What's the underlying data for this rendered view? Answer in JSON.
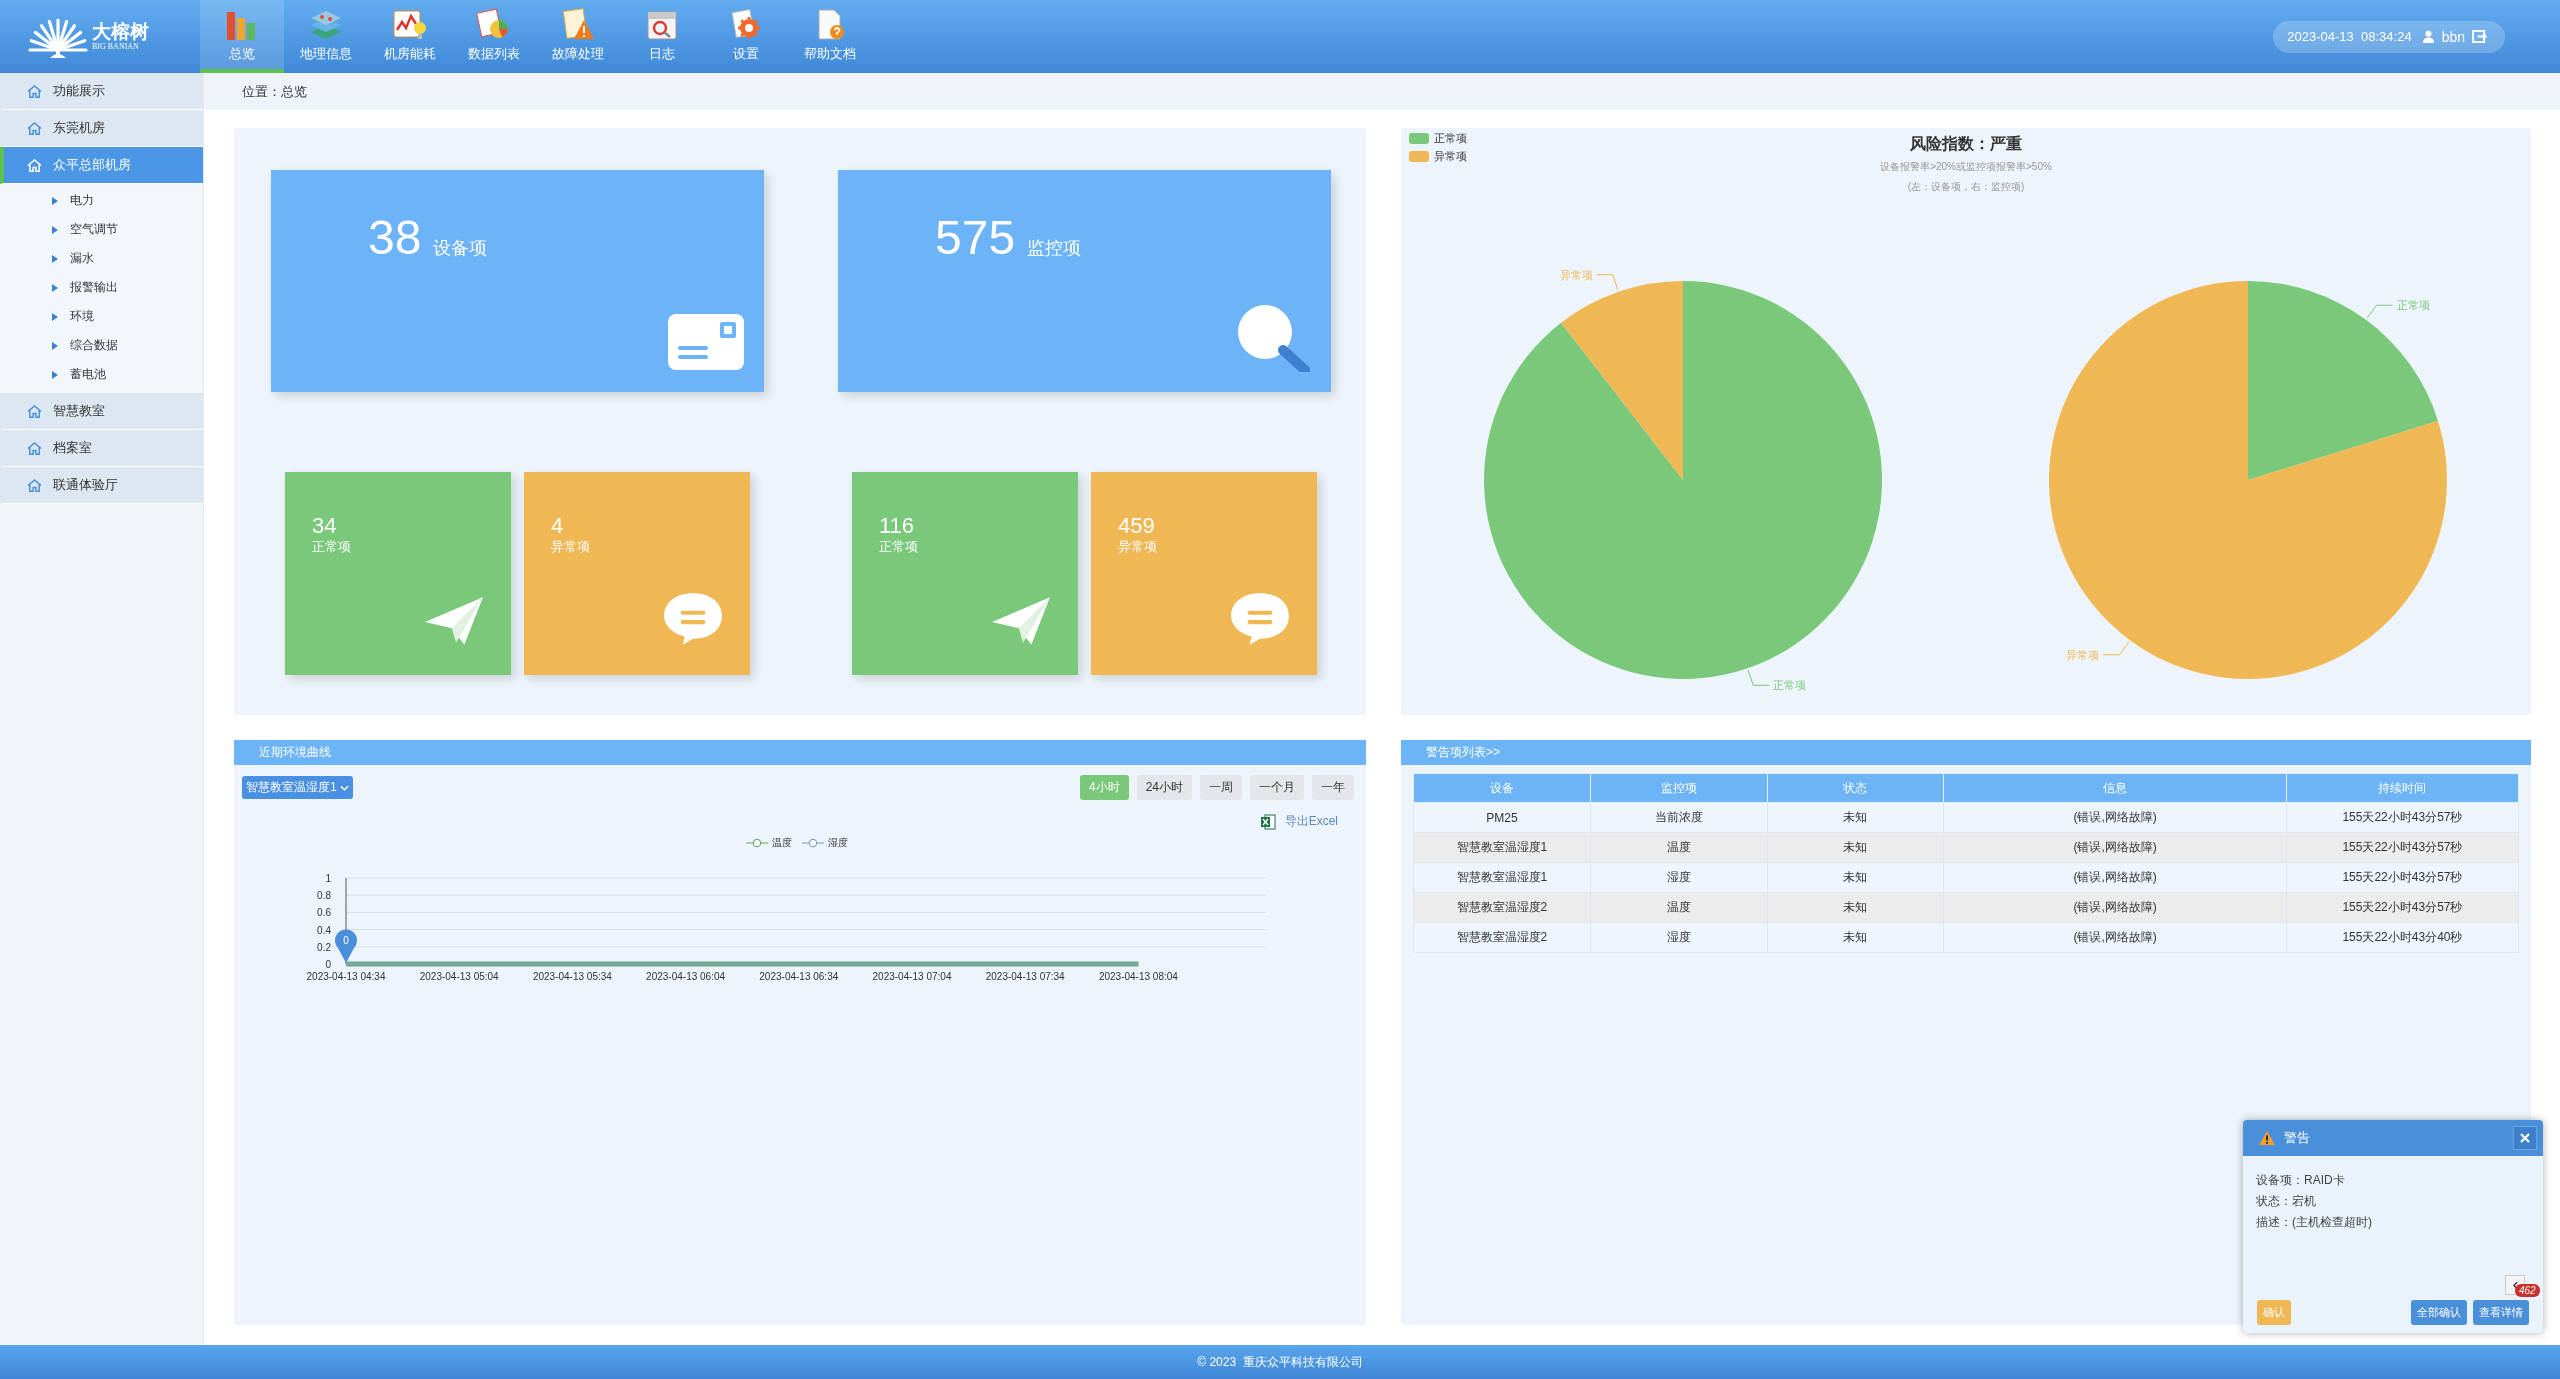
{
  "header": {
    "logo": {
      "name": "大榕树",
      "subtitle": "BIG BANIAN"
    },
    "nav": [
      {
        "label": "总览",
        "selected": true,
        "kind": "overview"
      },
      {
        "label": "地理信息",
        "selected": false,
        "kind": "geo"
      },
      {
        "label": "机房能耗",
        "selected": false,
        "kind": "energy"
      },
      {
        "label": "数据列表",
        "selected": false,
        "kind": "data"
      },
      {
        "label": "故障处理",
        "selected": false,
        "kind": "fault"
      },
      {
        "label": "日志",
        "selected": false,
        "kind": "log"
      },
      {
        "label": "设置",
        "selected": false,
        "kind": "settings"
      },
      {
        "label": "帮助文档",
        "selected": false,
        "kind": "help"
      }
    ],
    "datetime": "2023-04-13  08:34:24",
    "user": "bbn"
  },
  "sidebar": {
    "items": [
      {
        "label": "功能展示",
        "selected": false
      },
      {
        "label": "东莞机房",
        "selected": false
      },
      {
        "label": "众平总部机房",
        "selected": true,
        "children": [
          {
            "label": "电力"
          },
          {
            "label": "空气调节"
          },
          {
            "label": "漏水"
          },
          {
            "label": "报警输出"
          },
          {
            "label": "环境"
          },
          {
            "label": "综合数据"
          },
          {
            "label": "蓄电池"
          }
        ]
      },
      {
        "label": "智慧教室",
        "selected": false
      },
      {
        "label": "档案室",
        "selected": false
      },
      {
        "label": "联通体验厅",
        "selected": false
      }
    ]
  },
  "breadcrumb": "位置：总览",
  "summary": {
    "groups": [
      {
        "kind": "device",
        "total": "38",
        "total_label": "设备项",
        "normal": "34",
        "normal_label": "正常项",
        "abnormal": "4",
        "abnormal_label": "异常项"
      },
      {
        "kind": "monitor",
        "total": "575",
        "total_label": "监控项",
        "normal": "116",
        "normal_label": "正常项",
        "abnormal": "459",
        "abnormal_label": "异常项"
      }
    ]
  },
  "risk_chart": {
    "title": "风险指数：严重",
    "subtitle": "设备报警率>20%或监控项报警率>50%",
    "note": "(左：设备项，右：监控项)",
    "legend": [
      {
        "label": "正常项",
        "color": "#7ac97a"
      },
      {
        "label": "异常项",
        "color": "#f0b755"
      }
    ],
    "pies": [
      {
        "chart_data": {
          "type": "pie",
          "categories": [
            "正常项",
            "异常项"
          ],
          "values": [
            89.5,
            10.5
          ]
        }
      },
      {
        "chart_data": {
          "type": "pie",
          "categories": [
            "正常项",
            "异常项"
          ],
          "values": [
            20.2,
            79.8
          ]
        }
      }
    ]
  },
  "trend": {
    "title": "近期环境曲线",
    "device_select": "智慧教室温湿度1",
    "ranges": [
      {
        "label": "4小时",
        "selected": true
      },
      {
        "label": "24小时",
        "selected": false
      },
      {
        "label": "一周",
        "selected": false
      },
      {
        "label": "一个月",
        "selected": false
      },
      {
        "label": "一年",
        "selected": false
      }
    ],
    "export": "导出Excel",
    "chart_data": {
      "type": "line",
      "categories": [
        "2023-04-13 04:34",
        "2023-04-13 05:04",
        "2023-04-13 05:34",
        "2023-04-13 06:04",
        "2023-04-13 06:34",
        "2023-04-13 07:04",
        "2023-04-13 07:34",
        "2023-04-13 08:04"
      ],
      "series": [
        {
          "name": "温度",
          "color": "#6fae74",
          "values": [
            0,
            0,
            0,
            0,
            0,
            0,
            0,
            0
          ]
        },
        {
          "name": "湿度",
          "color": "#7fa3c4",
          "values": [
            0,
            0,
            0,
            0,
            0,
            0,
            0,
            0
          ]
        }
      ],
      "ylim": [
        0,
        1
      ],
      "yticks": [
        0,
        0.2,
        0.4,
        0.6,
        0.8,
        1
      ],
      "grid": true
    },
    "pin_label": "0"
  },
  "alerts": {
    "title": "警告项列表>>",
    "columns": [
      "设备",
      "监控项",
      "状态",
      "信息",
      "持续时间"
    ],
    "rows": [
      [
        "PM25",
        "当前浓度",
        "未知",
        "(错误,网络故障)",
        "155天22小时43分57秒"
      ],
      [
        "智慧教室温湿度1",
        "温度",
        "未知",
        "(错误,网络故障)",
        "155天22小时43分57秒"
      ],
      [
        "智慧教室温湿度1",
        "湿度",
        "未知",
        "(错误,网络故障)",
        "155天22小时43分57秒"
      ],
      [
        "智慧教室温湿度2",
        "温度",
        "未知",
        "(错误,网络故障)",
        "155天22小时43分57秒"
      ],
      [
        "智慧教室温湿度2",
        "湿度",
        "未知",
        "(错误,网络故障)",
        "155天22小时43分40秒"
      ]
    ]
  },
  "popup": {
    "title": "警告",
    "lines": [
      "设备项：RAID卡",
      "状态：宕机",
      "描述：(主机检查超时)"
    ],
    "count": "462",
    "buttons": [
      {
        "label": "确认",
        "kind": "warning"
      },
      {
        "label": "全部确认",
        "kind": "primary"
      },
      {
        "label": "查看详情",
        "kind": "primary"
      }
    ]
  },
  "footer": "© 2023  重庆众平科技有限公司"
}
